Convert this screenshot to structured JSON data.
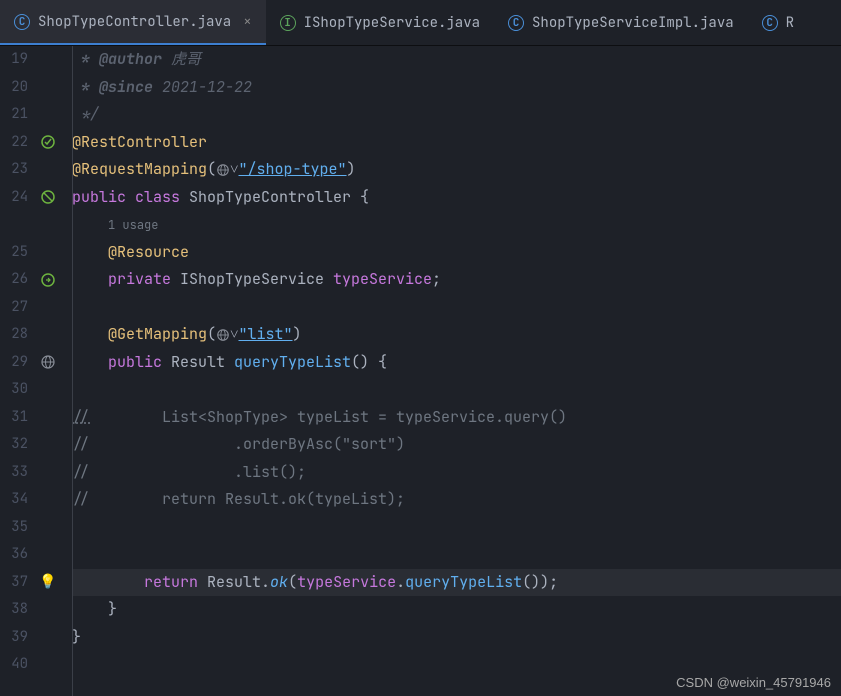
{
  "tabs": [
    {
      "label": "ShopTypeController.java",
      "iconType": "C"
    },
    {
      "label": "IShopTypeService.java",
      "iconType": "I"
    },
    {
      "label": "ShopTypeServiceImpl.java",
      "iconType": "C"
    },
    {
      "label": "R",
      "iconType": "C"
    }
  ],
  "lines": {
    "start": 19,
    "end": 40,
    "usageText": "1 usage",
    "code19_author_tag": " * @author",
    "code19_author": " 虎哥",
    "code20_since_tag": " * @since",
    "code20_since": " 2021-12-22",
    "code21": " */",
    "code22": "@RestController",
    "code23_ann": "@RequestMapping",
    "code23_str": "\"/shop-type\"",
    "code24_pub": "public ",
    "code24_class": "class ",
    "code24_name": "ShopTypeController ",
    "code24_brace": "{",
    "code25": "    @Resource",
    "code26_priv": "    private ",
    "code26_type": "IShopTypeService ",
    "code26_var": "typeService",
    "code26_semi": ";",
    "code28_ann": "    @GetMapping",
    "code28_list": "\"list\"",
    "code29_pub": "    public ",
    "code29_ret": "Result ",
    "code29_meth": "queryTypeList",
    "code29_tail": "() {",
    "code31": "//        List<ShopType> typeList = typeService.query()",
    "code32": "//                .orderByAsc(\"sort\")",
    "code33": "//                .list();",
    "code34": "//        return Result.ok(typeList);",
    "code37_ret": "        return ",
    "code37_res": "Result.",
    "code37_ok": "ok",
    "code37_paren": "(",
    "code37_ts": "typeService",
    "code37_dot": ".",
    "code37_qtl": "queryTypeList",
    "code37_end": "());",
    "code38": "    }",
    "code39": "}"
  },
  "watermark": "CSDN @weixin_45791946"
}
